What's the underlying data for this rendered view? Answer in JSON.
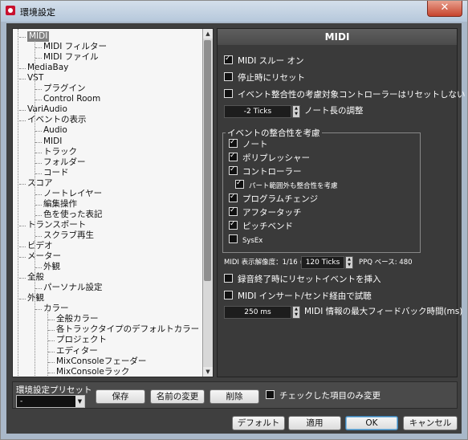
{
  "window": {
    "title": "環境設定",
    "close_label": "✕"
  },
  "tree": {
    "items": [
      {
        "label": "MIDI",
        "depth": 1,
        "selected": true
      },
      {
        "label": "MIDI フィルター",
        "depth": 2
      },
      {
        "label": "MIDI ファイル",
        "depth": 2
      },
      {
        "label": "MediaBay",
        "depth": 1
      },
      {
        "label": "VST",
        "depth": 1
      },
      {
        "label": "プラグイン",
        "depth": 2
      },
      {
        "label": "Control Room",
        "depth": 2
      },
      {
        "label": "VariAudio",
        "depth": 1
      },
      {
        "label": "イベントの表示",
        "depth": 1
      },
      {
        "label": "Audio",
        "depth": 2
      },
      {
        "label": "MIDI",
        "depth": 2
      },
      {
        "label": "トラック",
        "depth": 2
      },
      {
        "label": "フォルダー",
        "depth": 2
      },
      {
        "label": "コード",
        "depth": 2
      },
      {
        "label": "スコア",
        "depth": 1
      },
      {
        "label": "ノートレイヤー",
        "depth": 2
      },
      {
        "label": "編集操作",
        "depth": 2
      },
      {
        "label": "色を使った表記",
        "depth": 2
      },
      {
        "label": "トランスポート",
        "depth": 1
      },
      {
        "label": "スクラブ再生",
        "depth": 2
      },
      {
        "label": "ビデオ",
        "depth": 1
      },
      {
        "label": "メーター",
        "depth": 1
      },
      {
        "label": "外観",
        "depth": 2
      },
      {
        "label": "全般",
        "depth": 1
      },
      {
        "label": "パーソナル設定",
        "depth": 2
      },
      {
        "label": "外観",
        "depth": 1
      },
      {
        "label": "カラー",
        "depth": 2
      },
      {
        "label": "全般カラー",
        "depth": 3
      },
      {
        "label": "各トラックタイプのデフォルトカラー",
        "depth": 3
      },
      {
        "label": "プロジェクト",
        "depth": 3
      },
      {
        "label": "エディター",
        "depth": 3
      },
      {
        "label": "MixConsoleフェーダー",
        "depth": 3
      },
      {
        "label": "MixConsoleラック",
        "depth": 3
      }
    ]
  },
  "midi": {
    "header": "MIDI",
    "midi_thru": "MIDI スルー オン",
    "reset_on_stop": "停止時にリセット",
    "no_reset_controller": "イベント整合性の考慮対象コントローラーはリセットしない",
    "length_value": "-2 Ticks",
    "length_label": "ノート長の調整",
    "chase_group": "イベントの整合性を考慮",
    "chase_note": "ノート",
    "chase_poly": "ポリプレッシャー",
    "chase_controller": "コントローラー",
    "chase_outside": "パート範囲外も整合性を考慮",
    "chase_program": "プログラムチェンジ",
    "chase_aftertouch": "アフタータッチ",
    "chase_pitchbend": "ピッチベンド",
    "chase_sysex": "SysEx",
    "resolution_label": "MIDI 表示解像度：1/16 =",
    "resolution_value": "120 Ticks",
    "ppq_label": "PPQ ベース: 480",
    "insert_reset": "録音終了時にリセットイベントを挿入",
    "audition": "MIDI インサート/センド経由で試聴",
    "feedback_value": "250 ms",
    "feedback_label": "MIDI 情報の最大フィードバック時間(ms)"
  },
  "presets": {
    "label": "環境設定プリセット",
    "selected": "-",
    "save": "保存",
    "rename": "名前の変更",
    "delete": "削除",
    "only_checked": "チェックした項目のみ変更"
  },
  "footer": {
    "default": "デフォルト",
    "apply": "適用",
    "ok": "OK",
    "cancel": "キャンセル"
  }
}
